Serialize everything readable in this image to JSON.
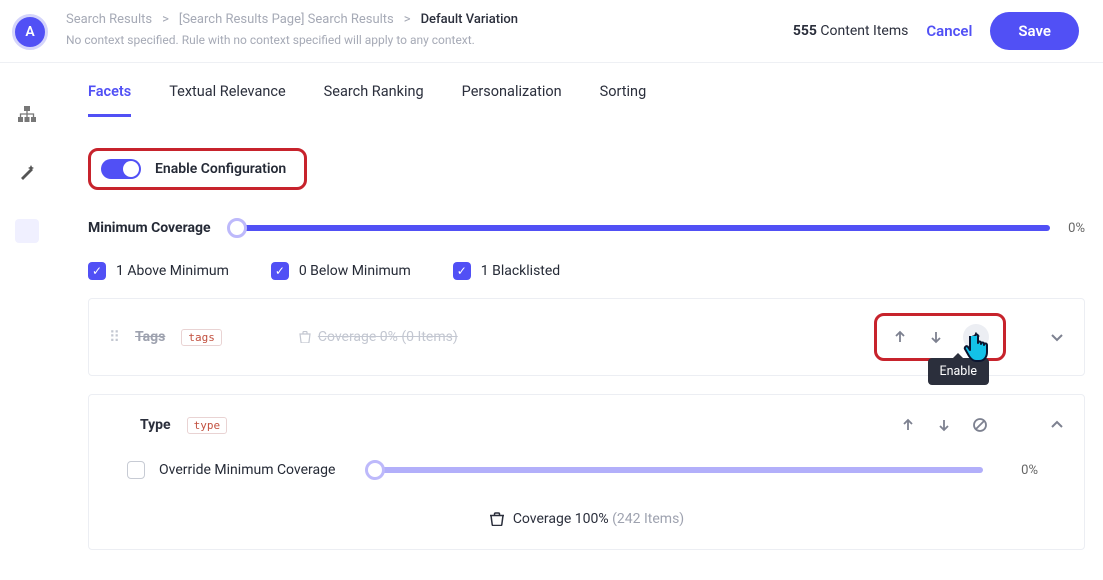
{
  "header": {
    "avatar_letter": "A",
    "crumbs": [
      "Search Results",
      "[Search Results Page] Search Results",
      "Default Variation"
    ],
    "no_context": "No context specified. Rule with no context specified will apply to any context.",
    "content_items_count": "555",
    "content_items_label": " Content Items",
    "cancel": "Cancel",
    "save": "Save"
  },
  "tabs": [
    "Facets",
    "Textual Relevance",
    "Search Ranking",
    "Personalization",
    "Sorting"
  ],
  "enable_label": "Enable Configuration",
  "min_cov": {
    "label": "Minimum Coverage",
    "pct": "0%"
  },
  "checks": {
    "above": "1 Above Minimum",
    "below": "0 Below Minimum",
    "black": "1 Blacklisted"
  },
  "facets": {
    "tags": {
      "name": "Tags",
      "tag": "tags",
      "coverage": "Coverage 0% (0 Items)"
    },
    "type": {
      "name": "Type",
      "tag": "type",
      "override": "Override Minimum Coverage",
      "pct": "0%",
      "coverage_label": "Coverage 100% ",
      "coverage_items": "(242 Items)"
    }
  },
  "tooltip": "Enable",
  "icons": {
    "sep": ">"
  }
}
